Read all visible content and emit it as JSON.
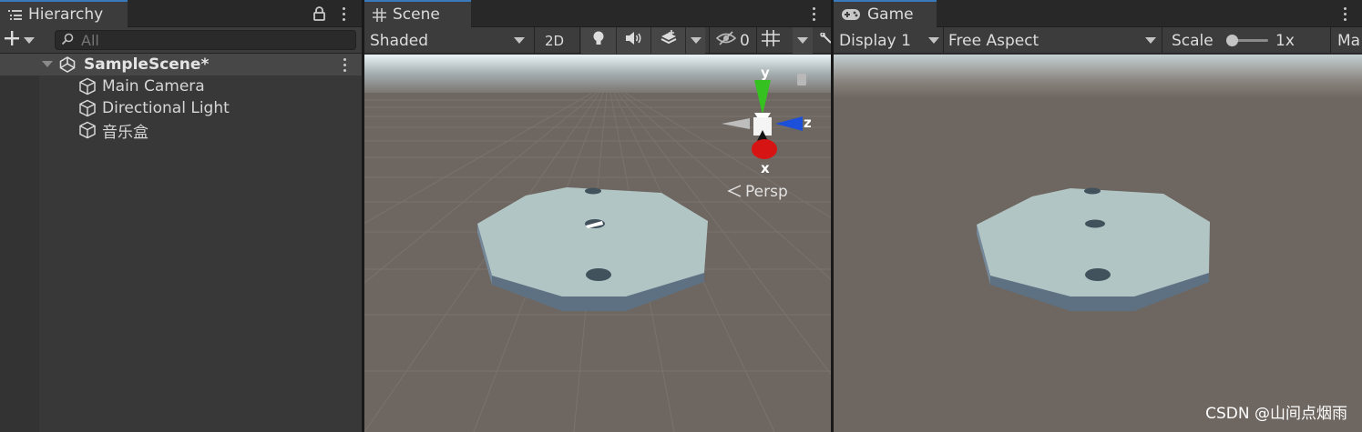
{
  "hierarchy": {
    "tab_label": "Hierarchy",
    "search_placeholder": "All",
    "scene_name": "SampleScene*",
    "items": [
      {
        "label": "Main Camera"
      },
      {
        "label": "Directional Light"
      },
      {
        "label": "音乐盒"
      }
    ]
  },
  "scene": {
    "tab_label": "Scene",
    "shading_mode": "Shaded",
    "toggle_2d": "2D",
    "hidden_count": "0",
    "projection_label": "Persp",
    "gizmo_axes": {
      "y": "y",
      "z": "z",
      "x": "x"
    }
  },
  "game": {
    "tab_label": "Game",
    "display": "Display 1",
    "aspect": "Free Aspect",
    "scale_label": "Scale",
    "scale_value": "1x",
    "scale_fraction": 0.0,
    "maximize_label": "Ma"
  },
  "watermark": "CSDN @山间点烟雨",
  "colors": {
    "accent_tab": "#3a79bb",
    "panel": "#383838",
    "ground": "#6e6660",
    "plate_top": "#b2c5c5",
    "plate_side": "#5e7182",
    "gizmo_y": "#35c11f",
    "gizmo_z": "#1d50d8",
    "gizmo_x": "#d71414"
  }
}
